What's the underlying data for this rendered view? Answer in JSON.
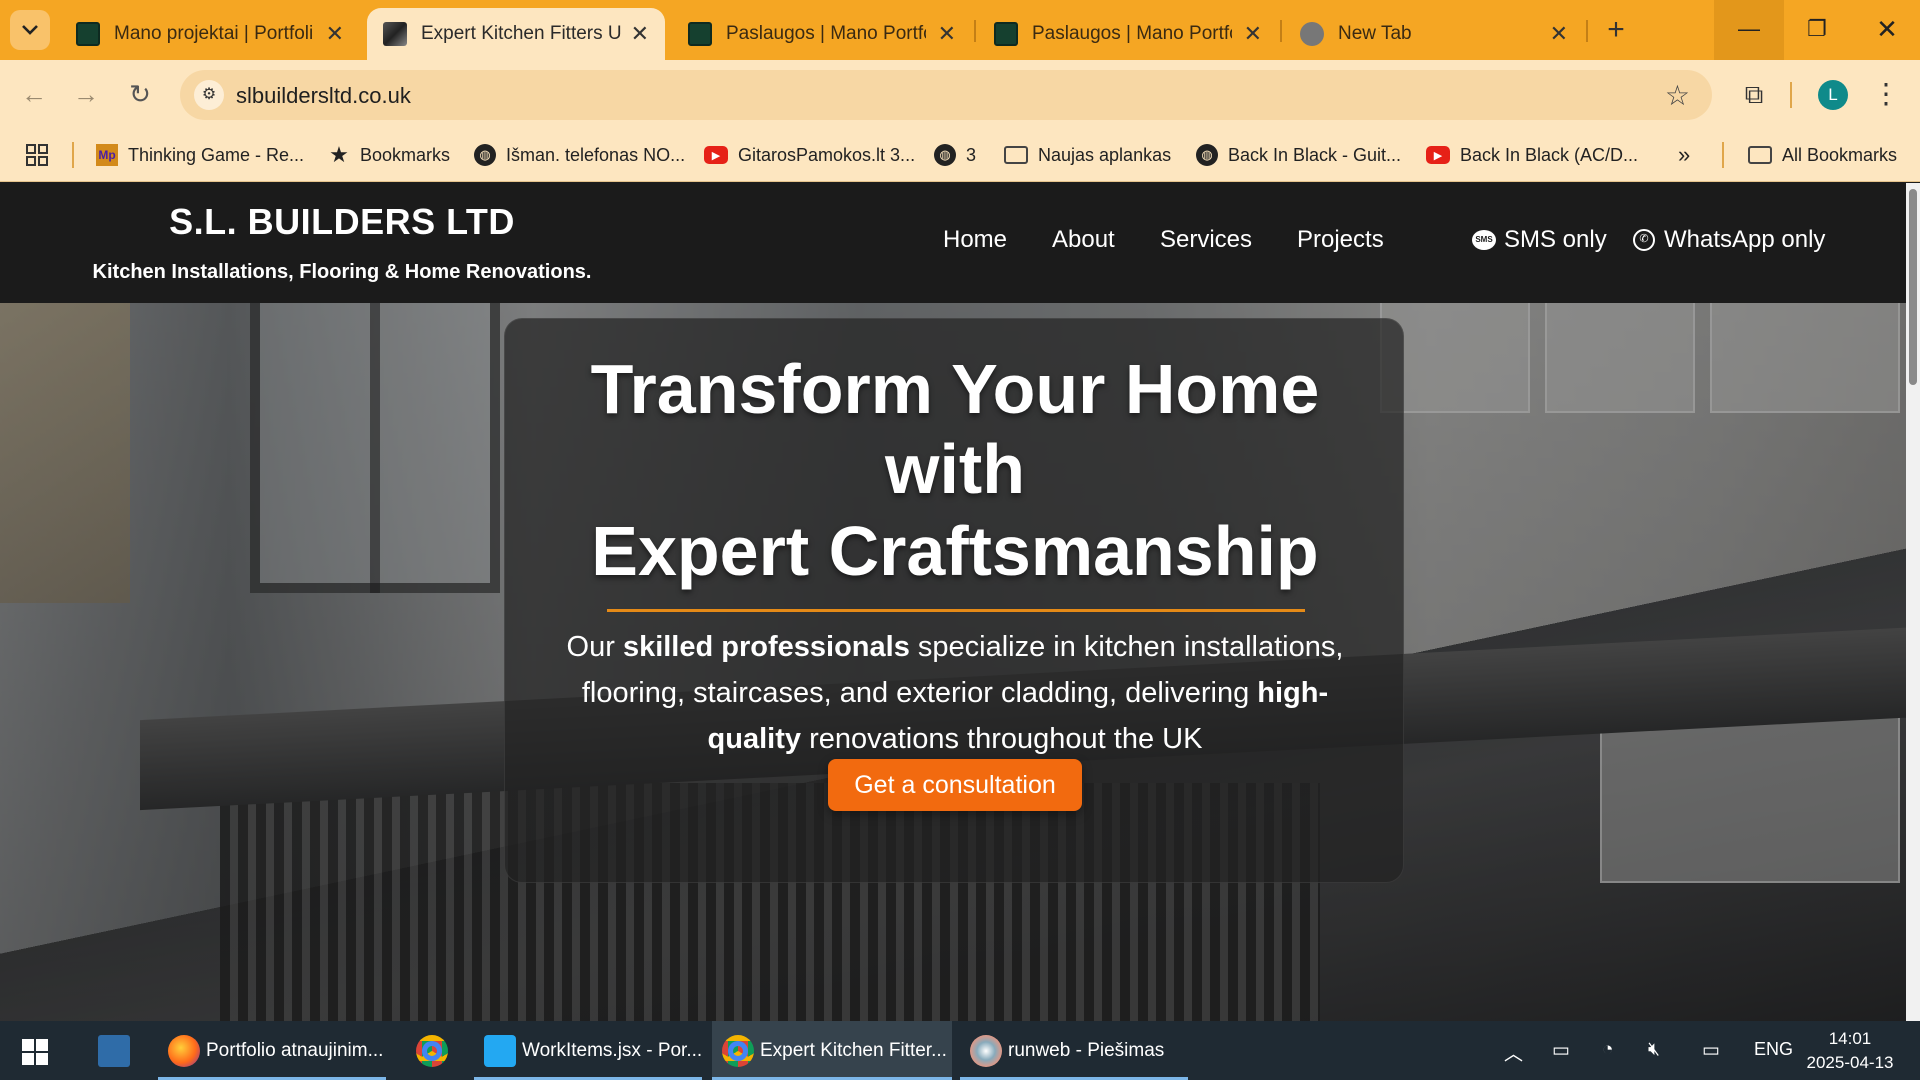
{
  "browser": {
    "tabs": [
      {
        "title": "Mano projektai | Portfolio",
        "active": false
      },
      {
        "title": "Expert Kitchen Fitters UK",
        "active": true
      },
      {
        "title": "Paslaugos | Mano Portfolio",
        "active": false
      },
      {
        "title": "Paslaugos | Mano Portfolio",
        "active": false
      },
      {
        "title": "New Tab",
        "active": false
      }
    ],
    "url": "slbuildersltd.co.uk",
    "profile_initial": "L",
    "bookmarks": [
      {
        "label": "Thinking Game - Re...",
        "icon": "mp-icon"
      },
      {
        "label": "Bookmarks",
        "icon": "star-icon"
      },
      {
        "label": "Išman. telefonas NO...",
        "icon": "globe-icon"
      },
      {
        "label": "GitarosPamokos.lt 3...",
        "icon": "youtube-icon"
      },
      {
        "label": "3",
        "icon": "globe-icon"
      },
      {
        "label": "Naujas aplankas",
        "icon": "folder-icon"
      },
      {
        "label": "Back In Black - Guit...",
        "icon": "globe-icon"
      },
      {
        "label": "Back In Black (AC/D...",
        "icon": "youtube-icon"
      }
    ],
    "all_bookmarks": "All Bookmarks"
  },
  "site": {
    "brand": {
      "name": "S.L. BUILDERS LTD",
      "tagline": "Kitchen Installations, Flooring & Home Renovations."
    },
    "nav": [
      "Home",
      "About",
      "Services",
      "Projects"
    ],
    "contact": {
      "sms": "SMS only",
      "whatsapp": "WhatsApp only"
    },
    "hero": {
      "line1": "Transform Your Home",
      "line2": "with",
      "line3": "Expert Craftsmanship",
      "p1": "Our ",
      "p1_bold": "skilled professionals",
      "p2": " specialize in kitchen installations, flooring, staircases, and exterior cladding, delivering ",
      "p2_bold": "high-quality",
      "p3": " renovations throughout the UK",
      "cta": "Get a consultation"
    },
    "colors": {
      "accent": "#f26a0f",
      "underline": "#e58a17",
      "header": "#1b1b1b"
    }
  },
  "taskbar": {
    "items": [
      {
        "label": "Portfolio atnaujinim...",
        "icon": "firefox-icon"
      },
      {
        "label": "",
        "icon": "chrome-icon"
      },
      {
        "label": "WorkItems.jsx - Por...",
        "icon": "vscode-icon"
      },
      {
        "label": "Expert Kitchen Fitter...",
        "icon": "chrome-icon"
      },
      {
        "label": "runweb - Piešimas",
        "icon": "paint-icon"
      }
    ],
    "language": "ENG",
    "time": "14:01",
    "date": "2025-04-13"
  }
}
